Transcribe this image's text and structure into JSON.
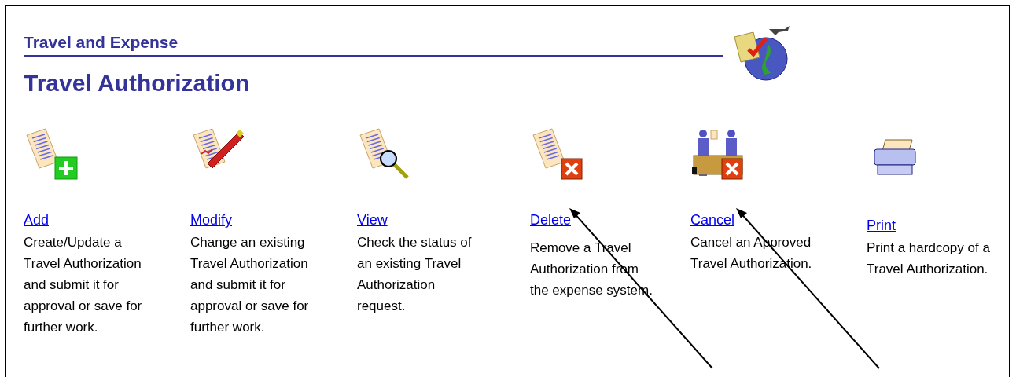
{
  "header": {
    "section": "Travel and Expense",
    "title": "Travel Authorization"
  },
  "actions": [
    {
      "kind": "add",
      "label": "Add",
      "description": "Create/Update a Travel Authorization and submit it for approval or save for further work.",
      "pointer_arrow": false
    },
    {
      "kind": "modify",
      "label": "Modify",
      "description": "Change an existing Travel Authorization and submit it for approval or save for further work.",
      "pointer_arrow": false
    },
    {
      "kind": "view",
      "label": "View",
      "description": "Check the status of an existing Travel Authorization request.",
      "pointer_arrow": false
    },
    {
      "kind": "delete",
      "label": "Delete",
      "description": "Remove a Travel Authorization from the expense system.",
      "pointer_arrow": true
    },
    {
      "kind": "cancel",
      "label": "Cancel",
      "description": "Cancel an Approved Travel Authorization.",
      "pointer_arrow": true
    },
    {
      "kind": "print",
      "label": "Print",
      "description": "Print a hardcopy of a Travel Authorization.",
      "pointer_arrow": false
    }
  ]
}
